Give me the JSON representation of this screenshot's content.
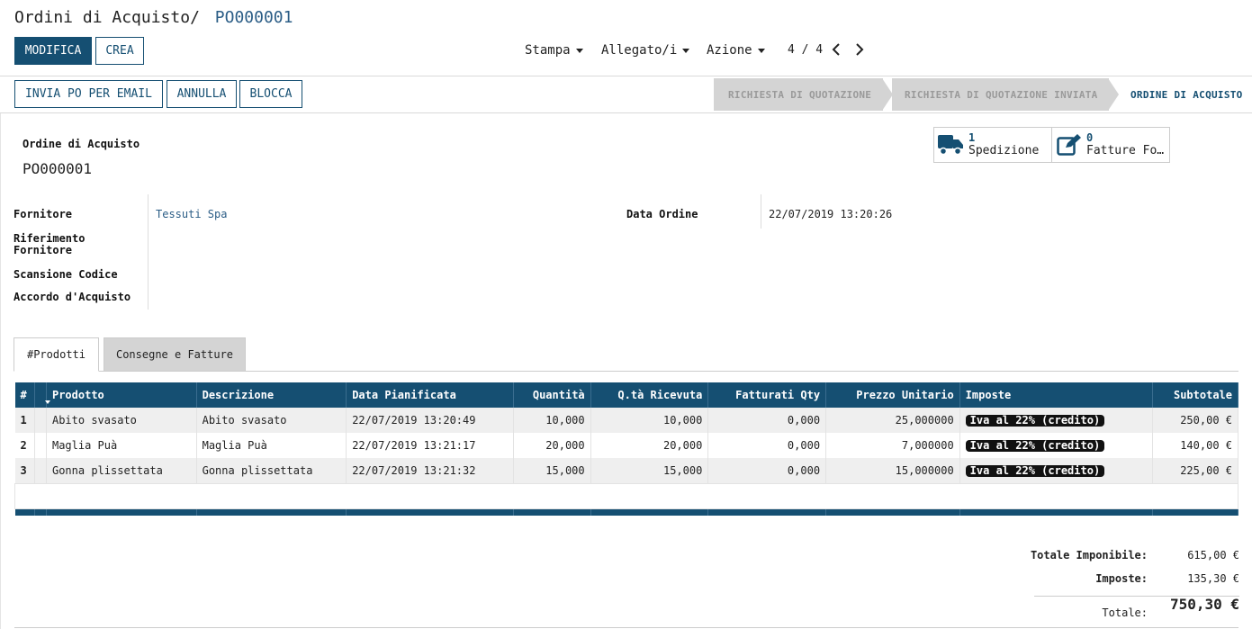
{
  "breadcrumb": {
    "root": "Ordini di Acquisto",
    "separator": "/",
    "current": "PO000001"
  },
  "toolbar": {
    "edit": "MODIFICA",
    "create": "CREA",
    "print": "Stampa",
    "attachments": "Allegato/i",
    "action": "Azione",
    "pager": "4 / 4"
  },
  "header_buttons": {
    "email": "INVIA PO PER EMAIL",
    "cancel": "ANNULLA",
    "lock": "BLOCCA"
  },
  "stages": [
    "RICHIESTA DI QUOTAZIONE",
    "RICHIESTA DI QUOTAZIONE INVIATA",
    "ORDINE DI ACQUISTO"
  ],
  "smart_buttons": {
    "shipment": {
      "count": "1",
      "label": "Spedizione"
    },
    "bills": {
      "count": "0",
      "label": "Fatture Fo…"
    }
  },
  "form": {
    "title_label": "Ordine di Acquisto",
    "name": "PO000001",
    "vendor_label": "Fornitore",
    "vendor": "Tessuti Spa",
    "vendor_ref_label": "Riferimento Fornitore",
    "scan_label": "Scansione Codice",
    "agreement_label": "Accordo d'Acquisto",
    "order_date_label": "Data Ordine",
    "order_date": "22/07/2019 13:20:26"
  },
  "tabs": [
    "#Prodotti",
    "Consegne e Fatture"
  ],
  "table": {
    "headers": [
      "#",
      "Prodotto",
      "Descrizione",
      "Data Pianificata",
      "Quantità",
      "Q.tà Ricevuta",
      "Fatturati Qty",
      "Prezzo Unitario",
      "Imposte",
      "Subtotale"
    ],
    "rows": [
      {
        "n": "1",
        "product": "Abito svasato",
        "desc": "Abito svasato",
        "date": "22/07/2019 13:20:49",
        "qty": "10,000",
        "received": "10,000",
        "invoiced": "0,000",
        "price": "25,000000",
        "tax": "Iva al 22% (credito)",
        "subtotal": "250,00 €"
      },
      {
        "n": "2",
        "product": "Maglia Puà",
        "desc": "Maglia Puà",
        "date": "22/07/2019 13:21:17",
        "qty": "20,000",
        "received": "20,000",
        "invoiced": "0,000",
        "price": "7,000000",
        "tax": "Iva al 22% (credito)",
        "subtotal": "140,00 €"
      },
      {
        "n": "3",
        "product": "Gonna plissettata",
        "desc": "Gonna plissettata",
        "date": "22/07/2019 13:21:32",
        "qty": "15,000",
        "received": "15,000",
        "invoiced": "0,000",
        "price": "15,000000",
        "tax": "Iva al 22% (credito)",
        "subtotal": "225,00 €"
      }
    ]
  },
  "totals": {
    "untaxed_label": "Totale Imponibile:",
    "untaxed": "615,00 €",
    "taxes_label": "Imposte:",
    "taxes": "135,30 €",
    "total_label": "Totale:",
    "total": "750,30 €"
  },
  "colors": {
    "primary": "#154f72",
    "stage_done": "#d4d4d4"
  }
}
